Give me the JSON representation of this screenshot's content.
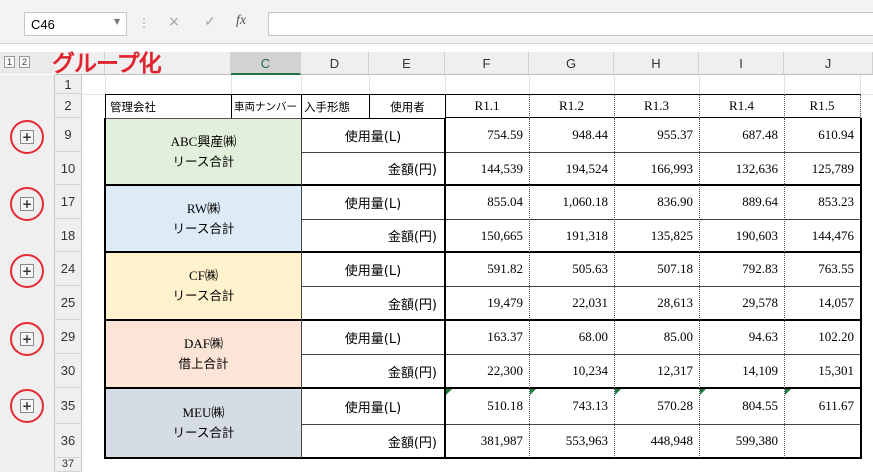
{
  "formula_bar": {
    "name_box": "C46",
    "fx": "fx",
    "formula": "",
    "cancel_icon": "×",
    "enter_icon": "✓",
    "sep": "⋮",
    "dropdown": "▼"
  },
  "annotation": {
    "title": "グループ化",
    "color": "#e0242f"
  },
  "outline_levels": [
    "1",
    "2"
  ],
  "columns": [
    "C",
    "D",
    "E",
    "F",
    "G",
    "H",
    "I",
    "J"
  ],
  "rows": [
    "1",
    "2",
    "9",
    "10",
    "17",
    "18",
    "24",
    "25",
    "29",
    "30",
    "35",
    "36",
    "37"
  ],
  "header_row": {
    "b": "管理会社",
    "c": "車両ナンバー",
    "d": "入手形態",
    "e": "使用者",
    "months": [
      "R1.1",
      "R1.2",
      "R1.3",
      "R1.4",
      "R1.5"
    ]
  },
  "groups": [
    {
      "name": "ABC興産㈱",
      "subtitle": "リース合計",
      "color": "#e2efda",
      "usage_label": "使用量(L)",
      "usage": [
        "754.59",
        "948.44",
        "955.37",
        "687.48",
        "610.94"
      ],
      "amount_label": "金額(円)",
      "amount": [
        "144,539",
        "194,524",
        "166,993",
        "132,636",
        "125,789"
      ]
    },
    {
      "name": "RW㈱",
      "subtitle": "リース合計",
      "color": "#ddebf7",
      "usage_label": "使用量(L)",
      "usage": [
        "855.04",
        "1,060.18",
        "836.90",
        "889.64",
        "853.23"
      ],
      "amount_label": "金額(円)",
      "amount": [
        "150,665",
        "191,318",
        "135,825",
        "190,603",
        "144,476"
      ]
    },
    {
      "name": "CF㈱",
      "subtitle": "リース合計",
      "color": "#fff2cc",
      "usage_label": "使用量(L)",
      "usage": [
        "591.82",
        "505.63",
        "507.18",
        "792.83",
        "763.55"
      ],
      "amount_label": "金額(円)",
      "amount": [
        "19,479",
        "22,031",
        "28,613",
        "29,578",
        "14,057"
      ]
    },
    {
      "name": "DAF㈱",
      "subtitle": "借上合計",
      "color": "#fce4d6",
      "usage_label": "使用量(L)",
      "usage": [
        "163.37",
        "68.00",
        "85.00",
        "94.63",
        "102.20"
      ],
      "amount_label": "金額(円)",
      "amount": [
        "22,300",
        "10,234",
        "12,317",
        "14,109",
        "15,301"
      ]
    },
    {
      "name": "MEU㈱",
      "subtitle": "リース合計",
      "color": "#d6dce4",
      "usage_label": "使用量(L)",
      "usage": [
        "510.18",
        "743.13",
        "570.28",
        "804.55",
        "611.67"
      ],
      "amount_label": "金額(円)",
      "amount": [
        "381,987",
        "553,963",
        "448,948",
        "599,380",
        ""
      ]
    }
  ],
  "expand_icon": "+"
}
